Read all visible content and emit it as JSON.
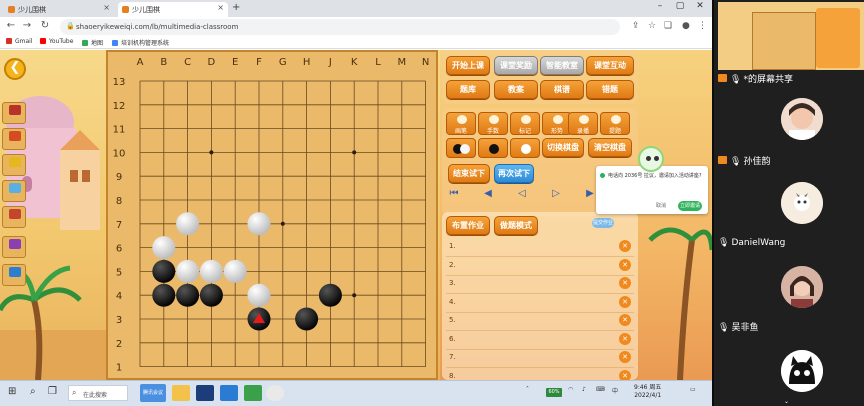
{
  "browser": {
    "tabs": [
      {
        "title": "少儿围棋",
        "active": false
      },
      {
        "title": "少儿围棋",
        "active": true
      }
    ],
    "url": "shaoeryikeweiqi.com/lb/multimedia-classroom",
    "bookmarks": [
      "Gmail",
      "YouTube",
      "地图",
      "培训机构管理系统"
    ]
  },
  "board": {
    "col_labels": [
      "A",
      "B",
      "C",
      "D",
      "E",
      "F",
      "G",
      "H",
      "J",
      "K",
      "L",
      "M",
      "N"
    ],
    "row_labels": [
      "13",
      "12",
      "11",
      "10",
      "9",
      "8",
      "7",
      "6",
      "5",
      "4",
      "3",
      "2",
      "1"
    ],
    "stones": [
      {
        "color": "white",
        "col": "C",
        "row": 7
      },
      {
        "color": "white",
        "col": "F",
        "row": 7
      },
      {
        "color": "white",
        "col": "B",
        "row": 6
      },
      {
        "color": "black",
        "col": "B",
        "row": 5
      },
      {
        "color": "white",
        "col": "C",
        "row": 5
      },
      {
        "color": "white",
        "col": "D",
        "row": 5
      },
      {
        "color": "white",
        "col": "E",
        "row": 5
      },
      {
        "color": "black",
        "col": "B",
        "row": 4
      },
      {
        "color": "black",
        "col": "C",
        "row": 4
      },
      {
        "color": "black",
        "col": "D",
        "row": 4
      },
      {
        "color": "white",
        "col": "F",
        "row": 4
      },
      {
        "color": "black",
        "col": "J",
        "row": 4
      },
      {
        "color": "black",
        "col": "F",
        "row": 3,
        "marked": true
      },
      {
        "color": "black",
        "col": "H",
        "row": 3
      }
    ],
    "star_points": [
      [
        "D",
        10
      ],
      [
        "K",
        10
      ],
      [
        "G",
        7
      ],
      [
        "K",
        4
      ]
    ]
  },
  "controls": {
    "row1": [
      "开始上课",
      "课堂奖励",
      "智能教室",
      "课堂互动"
    ],
    "row2": [
      "题库",
      "教案",
      "棋谱",
      "错题"
    ],
    "tools": [
      "画笔",
      "手数",
      "标记",
      "形势",
      "录播",
      "提题"
    ],
    "switch_board": "切换棋盘",
    "clear_board": "清空棋盘",
    "end_trial": "结束试下",
    "retry_trial": "再次试下",
    "assign_homework": "布置作业",
    "watch_mode": "做题模式",
    "submit_label": "提交作业",
    "homework_rows": [
      "1.",
      "2.",
      "3.",
      "4.",
      "5.",
      "6.",
      "7.",
      "8."
    ]
  },
  "popup": {
    "text": "电话向 2036号 拉议，邀请加入活动讲座?",
    "cancel": "取消",
    "confirm": "立即邀请"
  },
  "taskbar": {
    "search_placeholder": "在此搜索",
    "active_app": "腾讯会议",
    "battery": "60%",
    "time": "9:46 周五",
    "date": "2022/4/1"
  },
  "sidebar": {
    "participants": [
      {
        "name": "*的屏幕共享",
        "role": "screen"
      },
      {
        "name": "孙佳韵",
        "role": "user"
      },
      {
        "name": "DanielWang",
        "role": "user"
      },
      {
        "name": "吴非鱼",
        "role": "user"
      },
      {
        "name": "",
        "role": "user"
      }
    ]
  },
  "colors": {
    "orange_button": "#e9891f",
    "board": "#eab96a",
    "sand": "#f2c86f"
  },
  "icons": [
    "back-arrow-icon",
    "search-icon",
    "mic-icon",
    "screen-share-icon",
    "delete-icon"
  ]
}
